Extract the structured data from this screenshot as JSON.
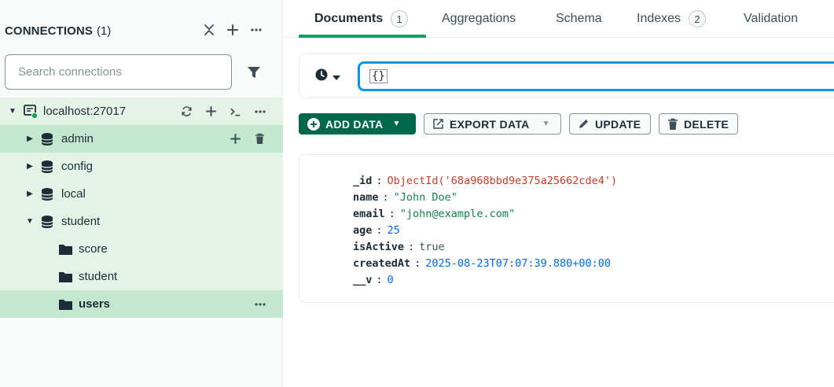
{
  "sidebar": {
    "title": "CONNECTIONS",
    "count": "(1)",
    "header_icons": [
      "collapse-icon",
      "plus-icon",
      "ellipsis-icon"
    ],
    "search": {
      "placeholder": "Search connections",
      "value": ""
    },
    "connection": {
      "label": "localhost:27017",
      "status_color": "#00a35c"
    },
    "databases": [
      {
        "label": "admin",
        "expanded": false
      },
      {
        "label": "config",
        "expanded": false
      },
      {
        "label": "local",
        "expanded": false
      },
      {
        "label": "student",
        "expanded": true
      }
    ],
    "collections": [
      {
        "label": "score"
      },
      {
        "label": "student"
      },
      {
        "label": "users",
        "selected": true
      }
    ]
  },
  "tabs": [
    {
      "label": "Documents",
      "badge": "1",
      "active": true
    },
    {
      "label": "Aggregations"
    },
    {
      "label": "Schema"
    },
    {
      "label": "Indexes",
      "badge": "2"
    },
    {
      "label": "Validation"
    }
  ],
  "query": {
    "value": "{}"
  },
  "toolbar": {
    "add_data": "ADD DATA",
    "export_data": "EXPORT DATA",
    "update": "UPDATE",
    "delete": "DELETE"
  },
  "document": {
    "fields": [
      {
        "key": "_id",
        "value": "ObjectId('68a968bbd9e375a25662cde4')",
        "type": "oid"
      },
      {
        "key": "name",
        "value": "\"John Doe\"",
        "type": "str"
      },
      {
        "key": "email",
        "value": "\"john@example.com\"",
        "type": "str"
      },
      {
        "key": "age",
        "value": "25",
        "type": "num"
      },
      {
        "key": "isActive",
        "value": "true",
        "type": "bool"
      },
      {
        "key": "createdAt",
        "value": "2025-08-23T07:07:39.880+00:00",
        "type": "date"
      },
      {
        "key": "__v",
        "value": "0",
        "type": "num"
      }
    ]
  },
  "colors": {
    "accent": "#00684a",
    "tab_underline": "#00a35c",
    "focus": "#0498ec",
    "tree_bg": "#e3f4e7",
    "tree_selected": "#c3e7cf"
  }
}
